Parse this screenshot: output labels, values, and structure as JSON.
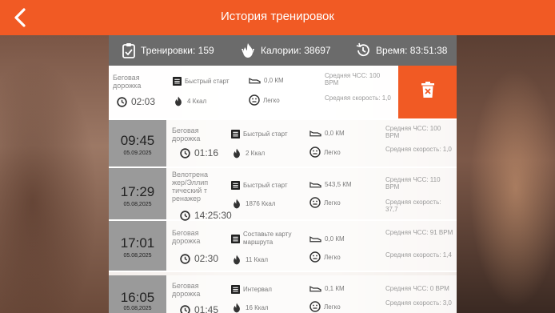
{
  "header": {
    "title": "История тренировок"
  },
  "summary": {
    "workouts": "Тренировки: 159",
    "calories": "Калории: 38697",
    "time": "Время: 83:51:38"
  },
  "expanded": {
    "name": "Беговая дорожка",
    "duration": "02:03",
    "mode": "Быстрый старт",
    "distance": "0,0 КМ",
    "kcal": "4 Ккал",
    "effort": "Легко",
    "hr": "Средняя ЧСС: 100 BPM",
    "speed": "Средняя скорость: 1,0"
  },
  "rows": [
    {
      "time": "09:45",
      "date": "05.09.2025",
      "name": "Беговая дорожка",
      "duration": "01:16",
      "mode": "Быстрый старт",
      "distance": "0,0 КМ",
      "kcal": "2 Ккал",
      "effort": "Легко",
      "hr": "Средняя ЧСС: 100 BPM",
      "speed": "Средняя скорость: 1,0"
    },
    {
      "time": "17:29",
      "date": "05.08,2025",
      "name": "Велотренажер/Эллиптический тренажер",
      "duration": "14:25:30",
      "mode": "Быстрый старт",
      "distance": "543,5 КМ",
      "kcal": "1876 Ккал",
      "effort": "Легко",
      "hr": "Средняя ЧСС: 110 BPM",
      "speed": "Средняя скорость: 37,7"
    },
    {
      "time": "17:01",
      "date": "05.08,2025",
      "name": "Беговая дорожка",
      "duration": "02:30",
      "mode": "Составьте карту маршрута",
      "distance": "0,0 КМ",
      "kcal": "11 Ккал",
      "effort": "Легко",
      "hr": "Средняя ЧСС: 91 BPM",
      "speed": "Средняя скорость: 1,4"
    },
    {
      "time": "16:05",
      "date": "05.08,2025",
      "name": "Беговая дорожка",
      "duration": "01:45",
      "mode": "Интервал",
      "distance": "0,1 КМ",
      "kcal": "16 Ккал",
      "effort": "Легко",
      "hr": "Средняя ЧСС: 0 BPM",
      "speed": "Средняя скорость: 3,0"
    }
  ],
  "colors": {
    "accent": "#f15a24",
    "summary_bg": "#6b6b6b",
    "time_box": "#9a9a9a"
  }
}
